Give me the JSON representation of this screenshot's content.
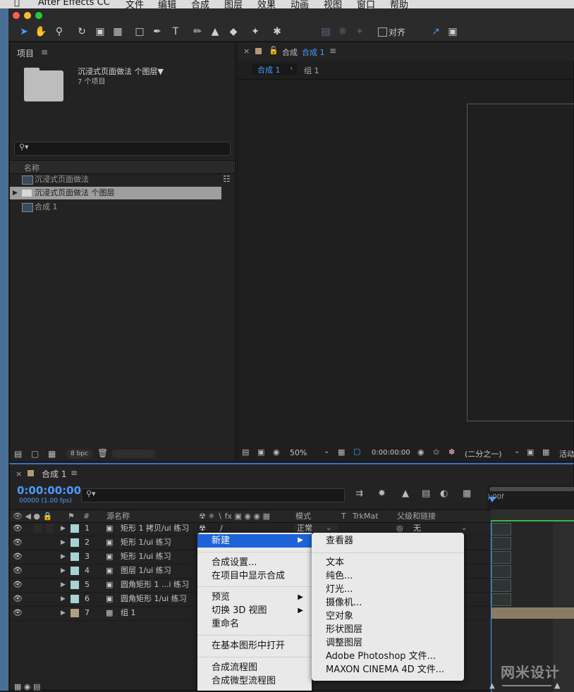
{
  "menubar": {
    "items": [
      "After Effects CC",
      "文件",
      "编辑",
      "合成",
      "图层",
      "效果",
      "动画",
      "视图",
      "窗口",
      "帮助"
    ]
  },
  "toolbar": {
    "snap_label": "对齐"
  },
  "project": {
    "panel_title": "项目",
    "selected_name": "沉浸式页面做法 个图层▼",
    "selected_info": "7 个项目",
    "search_placeholder": "",
    "col_name": "名称",
    "items": [
      {
        "name": "沉浸式页面做法",
        "kind": "comp"
      },
      {
        "name": "沉浸式页面做法 个图层",
        "kind": "folder"
      },
      {
        "name": "合成 1",
        "kind": "comp"
      }
    ],
    "bpc": "8 bpc"
  },
  "viewer": {
    "tab_label": "合成",
    "tab_comp": "合成 1",
    "crumb_active": "合成 1",
    "crumb_next": "组 1",
    "zoom": "50%",
    "timecode": "0:00:00:00",
    "resolution": "(二分之一)",
    "active_label": "活动"
  },
  "timeline": {
    "tab": "合成 1",
    "timecode": "0:00:00:00",
    "fps": "00000 (1.00 fps)",
    "col_num": "#",
    "col_source": "源名称",
    "col_mode": "模式",
    "col_t": "T",
    "col_trkmat": "TrkMat",
    "col_parent": "父级和链接",
    "ruler_start": "):00f",
    "layers": [
      {
        "num": "1",
        "name": "矩形 1 拷贝/ui 练习",
        "mode": "正常",
        "parent": "无",
        "color": "#a6d3d3"
      },
      {
        "num": "2",
        "name": "矩形 1/ui 练习",
        "color": "#a6d3d3"
      },
      {
        "num": "3",
        "name": "矩形 1/ui 练习",
        "color": "#a6d3d3"
      },
      {
        "num": "4",
        "name": "图层 1/ui 练习",
        "color": "#a6d3d3"
      },
      {
        "num": "5",
        "name": "圆角矩形 1 ...i 练习",
        "color": "#a6d3d3"
      },
      {
        "num": "6",
        "name": "圆角矩形 1/ui 练习",
        "color": "#a6d3d3"
      },
      {
        "num": "7",
        "name": "组 1",
        "color": "#b0a07e"
      }
    ]
  },
  "context_menu": {
    "items": [
      "新建",
      "合成设置...",
      "在项目中显示合成",
      "预览",
      "切换 3D 视图",
      "重命名",
      "在基本图形中打开",
      "合成流程图",
      "合成微型流程图"
    ]
  },
  "submenu": {
    "items": [
      "查看器",
      "文本",
      "纯色...",
      "灯光...",
      "摄像机...",
      "空对象",
      "形状图层",
      "调整图层",
      "Adobe Photoshop 文件...",
      "MAXON CINEMA 4D 文件..."
    ]
  },
  "watermark": "网米设计"
}
